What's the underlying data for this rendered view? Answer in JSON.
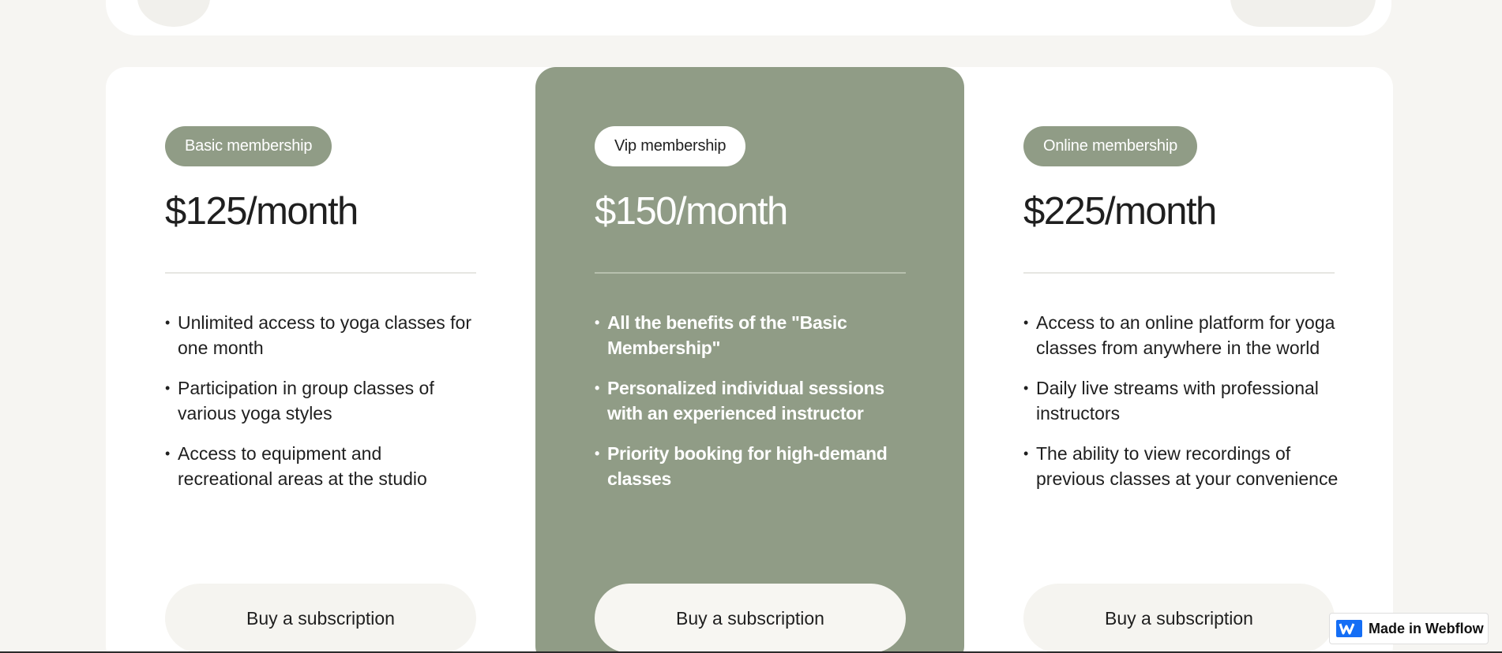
{
  "plans": [
    {
      "tag": "Basic membership",
      "price": "$125/month",
      "features": [
        "Unlimited access to yoga classes for one month",
        "Participation in group classes of various yoga styles",
        "Access to equipment and recreational areas at the studio"
      ],
      "cta": "Buy a subscription"
    },
    {
      "tag": "Vip membership",
      "price": "$150/month",
      "features": [
        "All the benefits of the \"Basic Membership\"",
        "Personalized individual sessions with an experienced instructor",
        "Priority booking for high-demand classes"
      ],
      "cta": "Buy a subscription"
    },
    {
      "tag": "Online membership",
      "price": "$225/month",
      "features": [
        "Access to an online platform for yoga classes from anywhere in the world",
        "Daily live streams with professional instructors",
        "The ability to view recordings of previous classes at your convenience"
      ],
      "cta": "Buy a subscription"
    }
  ],
  "badge": {
    "label": "Made in Webflow",
    "icon": "webflow-logo-icon"
  },
  "colors": {
    "page_background": "#f6f5f2",
    "card_background": "#ffffff",
    "accent_sage": "#909c86",
    "button_background": "#f5f4f0",
    "text": "#1f1f1f"
  }
}
